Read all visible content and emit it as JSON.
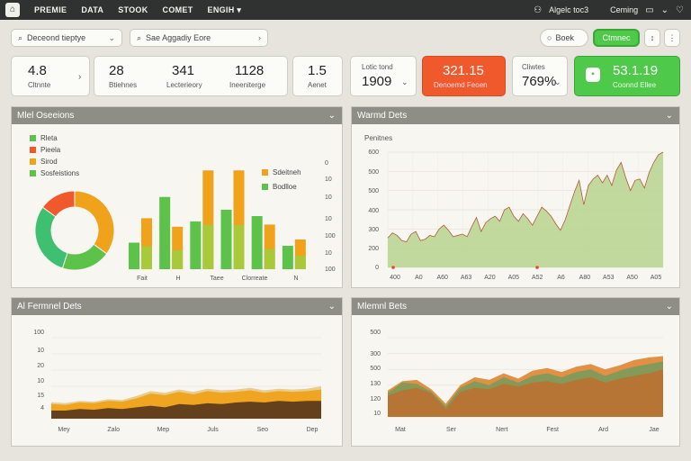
{
  "nav": {
    "items": [
      "PREMIE",
      "DATA",
      "STOOK",
      "COMET",
      "ENGIH"
    ],
    "right_label": "Algelc toc3",
    "right_link": "Ceming"
  },
  "toolbar": {
    "dropdown_label": "Deceond tieptye",
    "search_placeholder": "Sae Aggadiy Eore",
    "book_label": "Boek",
    "green_button_label": "Ctmnec"
  },
  "kpis": [
    {
      "value": "4.8",
      "label": "Cltnnte"
    },
    {
      "value": "28",
      "label": "Btiehnes"
    },
    {
      "value": "341",
      "label": "Lecterieory"
    },
    {
      "value": "1128",
      "label": "Ineeniterge"
    },
    {
      "value": "1.5",
      "label": "Aenet"
    },
    {
      "value": "1909",
      "label": "Lotic tond"
    },
    {
      "value": "321.15",
      "label": "Denoemd Feoen"
    },
    {
      "value": "769%",
      "label": "Cliwtes"
    },
    {
      "value": "53.1.19",
      "label": "Coonnd Ellee"
    }
  ],
  "colors": {
    "green": "#5cc24a",
    "orange": "#f0a21a",
    "red": "#f0592c",
    "dark": "#2f3230"
  },
  "chart_data": [
    {
      "type": "bar",
      "panel_title": "Mlel Oseeions",
      "donut_legend": [
        {
          "name": "Rleta",
          "color": "#5cc24a"
        },
        {
          "name": "Pieela",
          "color": "#f0592c"
        },
        {
          "name": "Sirod",
          "color": "#f0a21a"
        },
        {
          "name": "Sosfeistions",
          "color": "#5cc24a"
        }
      ],
      "donut_values": [
        35,
        20,
        30,
        15
      ],
      "donut_colors": [
        "#f0a21a",
        "#5cc24a",
        "#3ec070",
        "#f0592c"
      ],
      "bar_legend": [
        {
          "name": "Sdeitneh",
          "color": "#f0a21a"
        },
        {
          "name": "Bodlloe",
          "color": "#5cc24a"
        }
      ],
      "ylim": [
        0,
        100
      ],
      "yticks": [
        0,
        10,
        10,
        10,
        100,
        10,
        100
      ],
      "categories": [
        "Fait",
        "H",
        "Taee",
        "Clorreate",
        "N"
      ],
      "series": [
        {
          "name": "Sdeitneh",
          "values": [
            48,
            40,
            93,
            93,
            42,
            28
          ]
        },
        {
          "name": "Bodlloe",
          "values": [
            25,
            68,
            45,
            56,
            50,
            22
          ]
        }
      ]
    },
    {
      "type": "area",
      "panel_title": "Warmd Dets",
      "subtitle": "Penitnes",
      "ylim": [
        0,
        900
      ],
      "yticks": [
        0,
        200,
        300,
        400,
        500,
        500,
        600
      ],
      "xticks": [
        "400",
        "A0",
        "A60",
        "A63",
        "A20",
        "A05",
        "A52",
        "A6",
        "A80",
        "A53",
        "A50",
        "A05"
      ],
      "values": [
        230,
        270,
        250,
        210,
        200,
        260,
        280,
        210,
        220,
        250,
        240,
        300,
        330,
        290,
        240,
        250,
        260,
        240,
        320,
        390,
        280,
        350,
        380,
        400,
        360,
        450,
        470,
        400,
        360,
        420,
        380,
        330,
        400,
        470,
        440,
        400,
        340,
        290,
        370,
        480,
        590,
        680,
        490,
        640,
        690,
        720,
        660,
        720,
        640,
        760,
        820,
        700,
        600,
        680,
        690,
        620,
        740,
        820,
        880,
        900
      ]
    },
    {
      "type": "area",
      "panel_title": "Al Fermnel Dets",
      "ylim": [
        0,
        100
      ],
      "yticks": [
        100,
        10,
        20,
        10,
        15,
        4
      ],
      "xticks": [
        "Mey",
        "Zalo",
        "Mep",
        "Juls",
        "Seo",
        "Dep"
      ],
      "series": [
        {
          "name": "dark",
          "color": "#5c3a1e",
          "values": [
            10,
            10,
            12,
            11,
            13,
            12,
            14,
            16,
            14,
            18,
            17,
            19,
            18,
            20,
            21,
            20,
            22,
            21,
            22,
            22
          ]
        },
        {
          "name": "orange",
          "color": "#f0a21a",
          "values": [
            18,
            17,
            20,
            19,
            22,
            21,
            25,
            31,
            29,
            33,
            30,
            34,
            32,
            33,
            35,
            32,
            34,
            33,
            34,
            36
          ]
        },
        {
          "name": "tan",
          "color": "#e8c98a",
          "values": [
            20,
            19,
            22,
            21,
            24,
            23,
            28,
            34,
            32,
            36,
            33,
            37,
            35,
            36,
            38,
            35,
            37,
            36,
            37,
            40
          ]
        }
      ]
    },
    {
      "type": "area",
      "panel_title": "Mlemnl Bets",
      "ylim": [
        0,
        600
      ],
      "yticks": [
        500,
        300,
        500,
        130,
        120,
        10
      ],
      "xticks": [
        "Mat",
        "Ser",
        "Nert",
        "Fest",
        "Ard",
        "Jae"
      ],
      "series": [
        {
          "name": "brown",
          "color": "#b87333",
          "values": [
            160,
            200,
            220,
            180,
            60,
            190,
            220,
            210,
            250,
            230,
            260,
            270,
            250,
            280,
            300,
            260,
            290,
            310,
            330,
            360
          ]
        },
        {
          "name": "olive",
          "color": "#7f9a5a",
          "values": [
            180,
            260,
            250,
            190,
            80,
            220,
            270,
            240,
            300,
            260,
            310,
            330,
            300,
            340,
            360,
            310,
            350,
            380,
            400,
            420
          ]
        },
        {
          "name": "orange",
          "color": "#e08a3a",
          "values": [
            200,
            270,
            280,
            210,
            100,
            240,
            300,
            280,
            330,
            290,
            350,
            370,
            340,
            380,
            400,
            360,
            390,
            430,
            450,
            460
          ]
        }
      ]
    }
  ]
}
